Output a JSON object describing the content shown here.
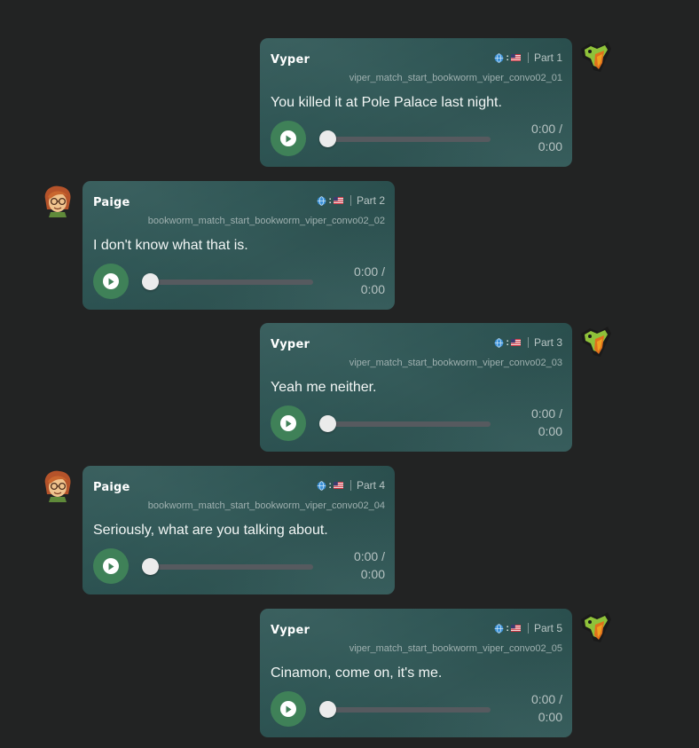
{
  "messages": [
    {
      "side": "right",
      "speaker": "Vyper",
      "part": "Part 1",
      "filename": "viper_match_start_bookworm_viper_convo02_01",
      "text": "You killed it at Pole Palace last night.",
      "time_current": "0:00 /",
      "time_total": "0:00",
      "progress": 0,
      "avatar_icon": "vyper-avatar-icon"
    },
    {
      "side": "left",
      "speaker": "Paige",
      "part": "Part 2",
      "filename": "bookworm_match_start_bookworm_viper_convo02_02",
      "text": "I don't know what that is.",
      "time_current": "0:00 /",
      "time_total": "0:00",
      "progress": 0,
      "avatar_icon": "paige-avatar-icon"
    },
    {
      "side": "right",
      "speaker": "Vyper",
      "part": "Part 3",
      "filename": "viper_match_start_bookworm_viper_convo02_03",
      "text": "Yeah me neither.",
      "time_current": "0:00 /",
      "time_total": "0:00",
      "progress": 0,
      "avatar_icon": "vyper-avatar-icon"
    },
    {
      "side": "left",
      "speaker": "Paige",
      "part": "Part 4",
      "filename": "bookworm_match_start_bookworm_viper_convo02_04",
      "text": "Seriously, what are you talking about.",
      "time_current": "0:00 /",
      "time_total": "0:00",
      "progress": 0,
      "avatar_icon": "paige-avatar-icon"
    },
    {
      "side": "right",
      "speaker": "Vyper",
      "part": "Part 5",
      "filename": "viper_match_start_bookworm_viper_convo02_05",
      "text": "Cinamon, come on, it's me.",
      "time_current": "0:00 /",
      "time_total": "0:00",
      "progress": 0,
      "avatar_icon": "vyper-avatar-icon"
    }
  ],
  "icons": {
    "language": "globe-icon",
    "flag": "us-flag-icon",
    "play": "play-icon"
  },
  "colors": {
    "background": "#222323",
    "bubble": "#2e5655",
    "play_button": "#3f8158",
    "text": "#f2f6f5",
    "muted": "#9eb0af"
  }
}
